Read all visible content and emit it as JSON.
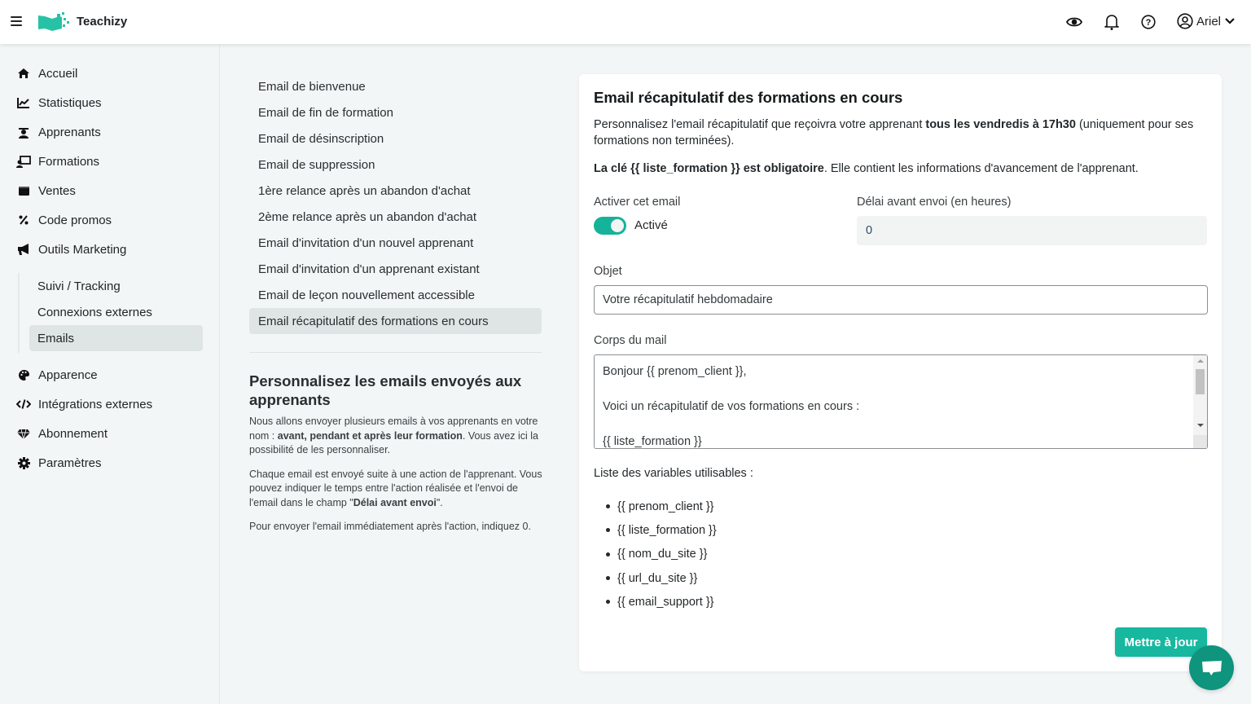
{
  "header": {
    "brand": "Teachizy",
    "user_name": "Ariel",
    "icons": [
      "menu-icon",
      "eye-icon",
      "bell-icon",
      "help-icon",
      "user-circle-icon",
      "chevron-down-icon"
    ]
  },
  "colors": {
    "accent": "#17b89f",
    "accent_dark": "#0f947e",
    "active_bg": "#dfe5e4"
  },
  "sidebar": {
    "items": [
      {
        "label": "Accueil",
        "icon": "home-icon"
      },
      {
        "label": "Statistiques",
        "icon": "chart-line-icon"
      },
      {
        "label": "Apprenants",
        "icon": "graduate-icon"
      },
      {
        "label": "Formations",
        "icon": "teacher-board-icon"
      },
      {
        "label": "Ventes",
        "icon": "wallet-icon"
      },
      {
        "label": "Code promos",
        "icon": "percent-icon"
      },
      {
        "label": "Outils Marketing",
        "icon": "megaphone-icon"
      },
      {
        "label": "Apparence",
        "icon": "palette-icon"
      },
      {
        "label": "Intégrations externes",
        "icon": "code-icon"
      },
      {
        "label": "Abonnement",
        "icon": "gem-icon"
      },
      {
        "label": "Paramètres",
        "icon": "gear-icon"
      }
    ],
    "sub_items": [
      {
        "label": "Suivi / Tracking"
      },
      {
        "label": "Connexions externes"
      },
      {
        "label": "Emails",
        "active": true
      }
    ]
  },
  "emails": {
    "items": [
      "Email de bienvenue",
      "Email de fin de formation",
      "Email de désinscription",
      "Email de suppression",
      "1ère relance après un abandon d'achat",
      "2ème relance après un abandon d'achat",
      "Email d'invitation d'un nouvel apprenant",
      "Email d'invitation d'un apprenant existant",
      "Email de leçon nouvellement accessible",
      "Email récapitulatif des formations en cours"
    ],
    "active_index": 9
  },
  "help": {
    "title": "Personnalisez les emails envoyés aux apprenants",
    "p1_a": "Nous allons envoyer plusieurs emails à vos apprenants en votre nom : ",
    "p1_bold": "avant, pendant et après leur formation",
    "p1_b": ". Vous avez ici la possibilité de les personnaliser.",
    "p2_a": "Chaque email est envoyé suite à une action de l'apprenant. Vous pouvez indiquer le temps entre l'action réalisée et l'envoi de l'email dans le champ \"",
    "p2_bold": "Délai avant envoi",
    "p2_b": "\".",
    "p3": "Pour envoyer l'email immédiatement après l'action, indiquez 0."
  },
  "editor": {
    "title": "Email récapitulatif des formations en cours",
    "desc_a": "Personnalisez l'email récapitulatif que reçoivra votre apprenant ",
    "desc_bold": "tous les vendredis à 17h30",
    "desc_b": " (uniquement pour ses formations non terminées).",
    "key_bold": "La clé {{ liste_formation }} est obligatoire",
    "key_rest": ". Elle contient les informations d'avancement de l'apprenant.",
    "activate_label": "Activer cet email",
    "toggle_on": true,
    "toggle_label": "Activé",
    "delay_label": "Délai avant envoi (en heures)",
    "delay_value": "0",
    "subject_label": "Objet",
    "subject_value": "Votre récapitulatif hebdomadaire",
    "body_label": "Corps du mail",
    "body_value": "Bonjour {{ prenom_client }},\n\nVoici un récapitulatif de vos formations en cours :\n\n{{ liste_formation }}",
    "variables_title": "Liste des variables utilisables :",
    "variables": [
      "{{ prenom_client }}",
      "{{ liste_formation }}",
      "{{ nom_du_site }}",
      "{{ url_du_site }}",
      "{{ email_support }}"
    ],
    "update_button": "Mettre à jour"
  }
}
